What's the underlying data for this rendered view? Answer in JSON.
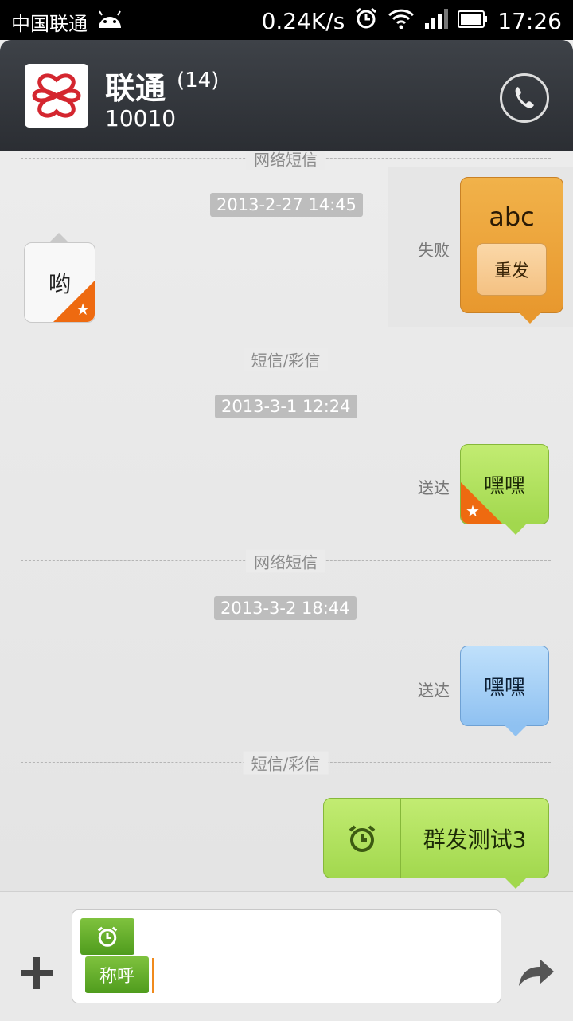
{
  "status_bar": {
    "carrier": "中国联通",
    "speed": "0.24K/s",
    "time": "17:26",
    "icons": [
      "android-icon",
      "alarm-icon",
      "wifi-icon",
      "signal-icon",
      "battery-icon"
    ]
  },
  "header": {
    "title": "联通",
    "count": "(14)",
    "number": "10010",
    "icons": [
      "unicom-logo",
      "phone-icon"
    ]
  },
  "thread": {
    "dividers": [
      "网络短信",
      "短信/彩信",
      "网络短信",
      "短信/彩信"
    ],
    "timestamps": [
      "2013-2-27 14:45",
      "2013-3-1 12:24",
      "2013-3-2 18:44"
    ],
    "messages": [
      {
        "direction": "incoming",
        "text": "哟",
        "starred": true
      },
      {
        "direction": "outgoing",
        "text": "abc",
        "status": "失败",
        "resend": "重发",
        "color": "#eda33d"
      },
      {
        "direction": "outgoing",
        "text": "嘿嘿",
        "status": "送达",
        "starred": true,
        "color": "#a9dd55"
      },
      {
        "direction": "outgoing",
        "text": "嘿嘿",
        "status": "送达",
        "color": "#9cc9f5"
      },
      {
        "direction": "outgoing",
        "text": "群发测试3",
        "scheduled": true,
        "color": "#a9dd55"
      }
    ]
  },
  "input": {
    "chip_label": "称呼",
    "icons": [
      "plus-icon",
      "alarm-chip-icon",
      "send-icon"
    ]
  },
  "colors": {
    "accent_green": "#6fb531",
    "accent_orange": "#ee6a10",
    "header_bg": "#34373c"
  }
}
